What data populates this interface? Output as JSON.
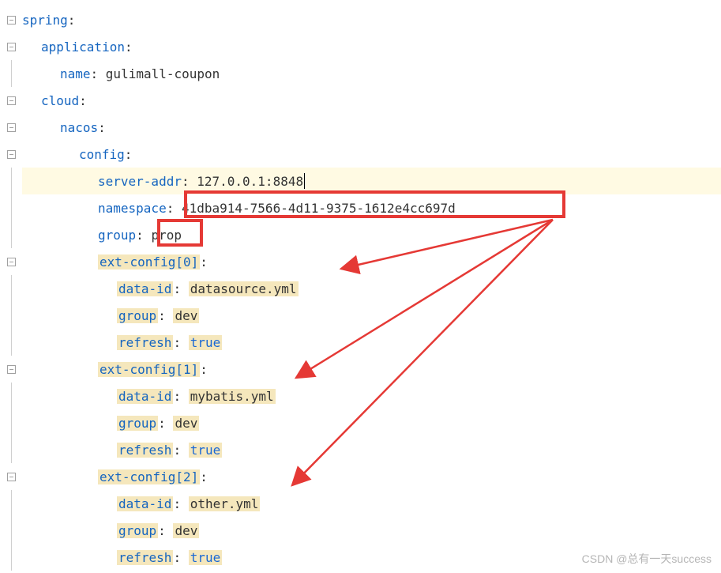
{
  "yaml": {
    "root": {
      "key": "spring",
      "colon": ":"
    },
    "application": {
      "key": "application",
      "colon": ":"
    },
    "app_name": {
      "key": "name",
      "colon": ": ",
      "value": "gulimall-coupon"
    },
    "cloud": {
      "key": "cloud",
      "colon": ":"
    },
    "nacos": {
      "key": "nacos",
      "colon": ":"
    },
    "config": {
      "key": "config",
      "colon": ":"
    },
    "server_addr": {
      "key": "server-addr",
      "colon": ": ",
      "value": "127.0.0.1:8848"
    },
    "namespace": {
      "key": "namespace",
      "colon": ": ",
      "value": "41dba914-7566-4d11-9375-1612e4cc697d"
    },
    "group": {
      "key": "group",
      "colon": ": ",
      "value": "prop"
    },
    "ext0": {
      "header": {
        "key": "ext-config[0]",
        "colon": ":"
      },
      "dataid": {
        "key": "data-id",
        "colon": ": ",
        "value": "datasource.yml"
      },
      "group": {
        "key": "group",
        "colon": ": ",
        "value": "dev"
      },
      "refresh": {
        "key": "refresh",
        "colon": ": ",
        "value": "true"
      }
    },
    "ext1": {
      "header": {
        "key": "ext-config[1]",
        "colon": ":"
      },
      "dataid": {
        "key": "data-id",
        "colon": ": ",
        "value": "mybatis.yml"
      },
      "group": {
        "key": "group",
        "colon": ": ",
        "value": "dev"
      },
      "refresh": {
        "key": "refresh",
        "colon": ": ",
        "value": "true"
      }
    },
    "ext2": {
      "header": {
        "key": "ext-config[2]",
        "colon": ":"
      },
      "dataid": {
        "key": "data-id",
        "colon": ": ",
        "value": "other.yml"
      },
      "group": {
        "key": "group",
        "colon": ": ",
        "value": "dev"
      },
      "refresh": {
        "key": "refresh",
        "colon": ": ",
        "value": "true"
      }
    }
  },
  "watermark": "CSDN @总有一天success"
}
